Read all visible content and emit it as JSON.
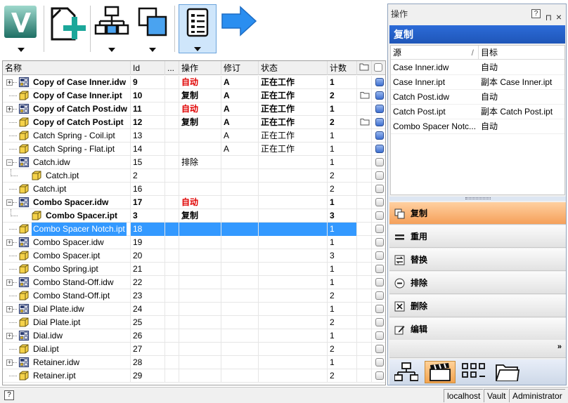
{
  "toolbar": {
    "buttons": [
      {
        "name": "vault-logo-button",
        "icon": "autodesk-vault-logo",
        "dropdown": true
      },
      {
        "name": "new-file-button",
        "icon": "new-document-plus-icon",
        "dropdown": false
      },
      {
        "name": "hierarchy-button",
        "icon": "hierarchy-icon",
        "dropdown": true
      },
      {
        "name": "overlap-button",
        "icon": "overlap-squares-icon",
        "dropdown": true
      },
      {
        "name": "list-view-button",
        "icon": "list-icon",
        "dropdown": true,
        "active": true
      },
      {
        "name": "next-arrow-button",
        "icon": "right-arrow-icon",
        "dropdown": false
      }
    ]
  },
  "grid": {
    "headers": {
      "name": "名称",
      "id": "Id",
      "more": "...",
      "action": "操作",
      "revision": "修订",
      "state": "状态",
      "count": "计数"
    },
    "rows": [
      {
        "name": "Copy of Case Inner.idw",
        "id": "9",
        "action": "自动",
        "rev": "A",
        "state": "正在工作",
        "count": "1",
        "bold": true,
        "red": true,
        "type": "idw",
        "expand": true,
        "indent": 0,
        "folder": false,
        "check": "blue"
      },
      {
        "name": "Copy of Case Inner.ipt",
        "id": "10",
        "action": "复制",
        "rev": "A",
        "state": "正在工作",
        "count": "2",
        "bold": true,
        "red": false,
        "type": "ipt",
        "expand": false,
        "indent": 0,
        "folder": true,
        "check": "blue"
      },
      {
        "name": "Copy of Catch Post.idw",
        "id": "11",
        "action": "自动",
        "rev": "A",
        "state": "正在工作",
        "count": "1",
        "bold": true,
        "red": true,
        "type": "idw",
        "expand": true,
        "indent": 0,
        "folder": false,
        "check": "blue"
      },
      {
        "name": "Copy of Catch Post.ipt",
        "id": "12",
        "action": "复制",
        "rev": "A",
        "state": "正在工作",
        "count": "2",
        "bold": true,
        "red": false,
        "type": "ipt",
        "expand": false,
        "indent": 0,
        "folder": true,
        "check": "blue"
      },
      {
        "name": "Catch Spring - Coil.ipt",
        "id": "13",
        "action": "",
        "rev": "A",
        "state": "正在工作",
        "count": "1",
        "bold": false,
        "red": false,
        "type": "ipt",
        "expand": false,
        "indent": 0,
        "folder": false,
        "check": "blue"
      },
      {
        "name": "Catch Spring - Flat.ipt",
        "id": "14",
        "action": "",
        "rev": "A",
        "state": "正在工作",
        "count": "1",
        "bold": false,
        "red": false,
        "type": "ipt",
        "expand": false,
        "indent": 0,
        "folder": false,
        "check": "blue"
      },
      {
        "name": "Catch.idw",
        "id": "15",
        "action": "排除",
        "rev": "",
        "state": "",
        "count": "1",
        "bold": false,
        "red": false,
        "type": "idw",
        "expand": "minus",
        "indent": 0,
        "folder": false,
        "check": "grey"
      },
      {
        "name": "Catch.ipt",
        "id": "2",
        "action": "",
        "rev": "",
        "state": "",
        "count": "2",
        "bold": false,
        "red": false,
        "type": "ipt",
        "expand": false,
        "indent": 1,
        "folder": false,
        "check": "grey"
      },
      {
        "name": "Catch.ipt",
        "id": "16",
        "action": "",
        "rev": "",
        "state": "",
        "count": "2",
        "bold": false,
        "red": false,
        "type": "ipt",
        "expand": false,
        "indent": 0,
        "folder": false,
        "check": "grey"
      },
      {
        "name": "Combo Spacer.idw",
        "id": "17",
        "action": "自动",
        "rev": "",
        "state": "",
        "count": "1",
        "bold": true,
        "red": true,
        "type": "idw",
        "expand": "minus",
        "indent": 0,
        "folder": false,
        "check": "grey"
      },
      {
        "name": "Combo Spacer.ipt",
        "id": "3",
        "action": "复制",
        "rev": "",
        "state": "",
        "count": "3",
        "bold": true,
        "red": false,
        "type": "ipt",
        "expand": false,
        "indent": 1,
        "folder": false,
        "check": "grey"
      },
      {
        "name": "Combo Spacer Notch.ipt",
        "id": "18",
        "action": "",
        "rev": "",
        "state": "",
        "count": "1",
        "bold": false,
        "red": false,
        "type": "ipt",
        "expand": false,
        "indent": 0,
        "folder": false,
        "check": "grey",
        "selected": true
      },
      {
        "name": "Combo Spacer.idw",
        "id": "19",
        "action": "",
        "rev": "",
        "state": "",
        "count": "1",
        "bold": false,
        "red": false,
        "type": "idw",
        "expand": true,
        "indent": 0,
        "folder": false,
        "check": "grey"
      },
      {
        "name": "Combo Spacer.ipt",
        "id": "20",
        "action": "",
        "rev": "",
        "state": "",
        "count": "3",
        "bold": false,
        "red": false,
        "type": "ipt",
        "expand": false,
        "indent": 0,
        "folder": false,
        "check": "grey"
      },
      {
        "name": "Combo Spring.ipt",
        "id": "21",
        "action": "",
        "rev": "",
        "state": "",
        "count": "1",
        "bold": false,
        "red": false,
        "type": "ipt",
        "expand": false,
        "indent": 0,
        "folder": false,
        "check": "grey"
      },
      {
        "name": "Combo Stand-Off.idw",
        "id": "22",
        "action": "",
        "rev": "",
        "state": "",
        "count": "1",
        "bold": false,
        "red": false,
        "type": "idw",
        "expand": true,
        "indent": 0,
        "folder": false,
        "check": "grey"
      },
      {
        "name": "Combo Stand-Off.ipt",
        "id": "23",
        "action": "",
        "rev": "",
        "state": "",
        "count": "2",
        "bold": false,
        "red": false,
        "type": "ipt",
        "expand": false,
        "indent": 0,
        "folder": false,
        "check": "grey"
      },
      {
        "name": "Dial Plate.idw",
        "id": "24",
        "action": "",
        "rev": "",
        "state": "",
        "count": "1",
        "bold": false,
        "red": false,
        "type": "idw",
        "expand": true,
        "indent": 0,
        "folder": false,
        "check": "grey"
      },
      {
        "name": "Dial Plate.ipt",
        "id": "25",
        "action": "",
        "rev": "",
        "state": "",
        "count": "2",
        "bold": false,
        "red": false,
        "type": "ipt",
        "expand": false,
        "indent": 0,
        "folder": false,
        "check": "grey"
      },
      {
        "name": "Dial.idw",
        "id": "26",
        "action": "",
        "rev": "",
        "state": "",
        "count": "1",
        "bold": false,
        "red": false,
        "type": "idw",
        "expand": true,
        "indent": 0,
        "folder": false,
        "check": "grey"
      },
      {
        "name": "Dial.ipt",
        "id": "27",
        "action": "",
        "rev": "",
        "state": "",
        "count": "2",
        "bold": false,
        "red": false,
        "type": "ipt",
        "expand": false,
        "indent": 0,
        "folder": false,
        "check": "grey"
      },
      {
        "name": "Retainer.idw",
        "id": "28",
        "action": "",
        "rev": "",
        "state": "",
        "count": "1",
        "bold": false,
        "red": false,
        "type": "idw",
        "expand": true,
        "indent": 0,
        "folder": false,
        "check": "grey"
      },
      {
        "name": "Retainer.ipt",
        "id": "29",
        "action": "",
        "rev": "",
        "state": "",
        "count": "2",
        "bold": false,
        "red": false,
        "type": "ipt",
        "expand": false,
        "indent": 0,
        "folder": false,
        "check": "grey"
      }
    ]
  },
  "panel": {
    "title": "操作",
    "help": "?",
    "close": "×",
    "section": "复制",
    "headers": {
      "source": "源",
      "target": "目标"
    },
    "rows": [
      {
        "source": "Case Inner.idw",
        "target": "自动"
      },
      {
        "source": "Case Inner.ipt",
        "target": "副本 Case Inner.ipt"
      },
      {
        "source": "Catch Post.idw",
        "target": "自动"
      },
      {
        "source": "Catch Post.ipt",
        "target": "副本 Catch Post.ipt"
      },
      {
        "source": "Combo Spacer Notc...",
        "target": "自动"
      }
    ],
    "actions": [
      {
        "label": "复制",
        "icon": "copy-icon",
        "active": true
      },
      {
        "label": "重用",
        "icon": "reuse-equals-icon",
        "active": false
      },
      {
        "label": "替换",
        "icon": "replace-icon",
        "active": false
      },
      {
        "label": "排除",
        "icon": "exclude-minus-icon",
        "active": false
      },
      {
        "label": "删除",
        "icon": "delete-x-icon",
        "active": false
      },
      {
        "label": "编辑",
        "icon": "edit-pencil-icon",
        "active": false
      }
    ],
    "nav": [
      "structure-icon",
      "clapper-icon",
      "grid-icon",
      "folder-icon"
    ]
  },
  "statusbar": {
    "help": "?",
    "server": "localhost",
    "vault": "Vault",
    "user": "Administrator"
  },
  "colors": {
    "accent": "#3399ff",
    "panelHeader": "#1f56b8",
    "active": "#f5a05a",
    "red": "#e00000"
  }
}
